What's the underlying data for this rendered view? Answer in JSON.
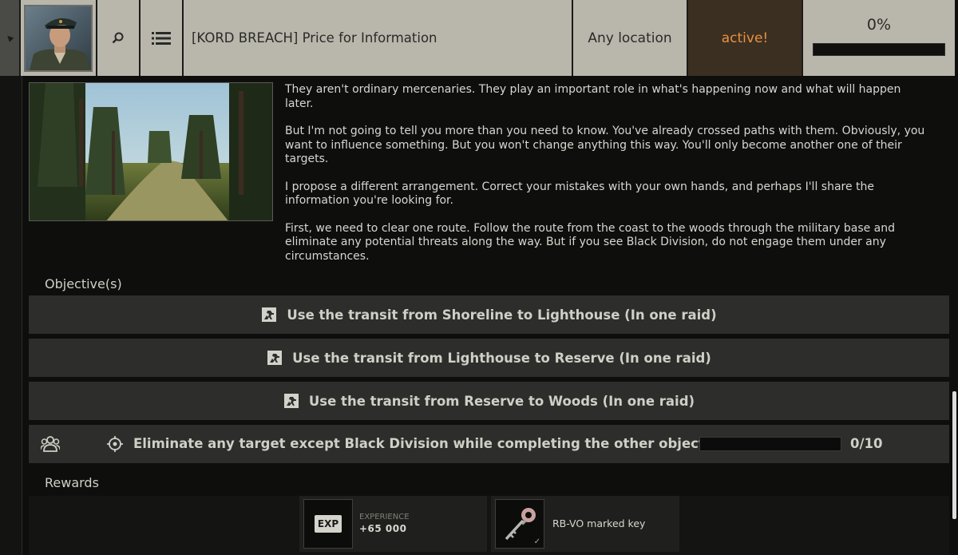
{
  "header": {
    "quest_title": "[KORD BREACH] Price for Information",
    "location": "Any location",
    "status": "active!",
    "progress_text": "0%",
    "progress_fraction": 0
  },
  "description": {
    "paragraphs": [
      "They aren't ordinary mercenaries. They play an important role in what's happening now and what will happen later.",
      "But I'm not going to tell you more than you need to know. You've already crossed paths with them. Obviously, you want to influence something. But you won't change anything this way. You'll only become another one of their targets.",
      "I propose a different arrangement. Correct your mistakes with your own hands, and perhaps I'll share the information you're looking for.",
      "First, we need to clear one route. Follow the route from the coast to the woods through the military base and eliminate any potential threats along the way. But if you see Black Division, do not engage them under any circumstances."
    ]
  },
  "objectives": {
    "label": "Objective(s)",
    "items": [
      "Use the transit from Shoreline to Lighthouse (In one raid)",
      "Use the transit from Lighthouse to Reserve (In one raid)",
      "Use the transit from Reserve to Woods (In one raid)"
    ],
    "elimination": {
      "text": "Eliminate any target except Black Division while completing the other objectives",
      "count": "0/10",
      "progress_fraction": 0
    }
  },
  "rewards": {
    "label": "Rewards",
    "experience": {
      "badge": "EXP",
      "label": "EXPERIENCE",
      "value": "+65 000"
    },
    "item": {
      "name": "RB-VO marked key",
      "icon": "key-icon"
    }
  },
  "colors": {
    "header_bg": "#b9b7ac",
    "status_bg": "#3b2f22",
    "status_text": "#e7923f",
    "objective_bg": "#2d2d2b"
  }
}
